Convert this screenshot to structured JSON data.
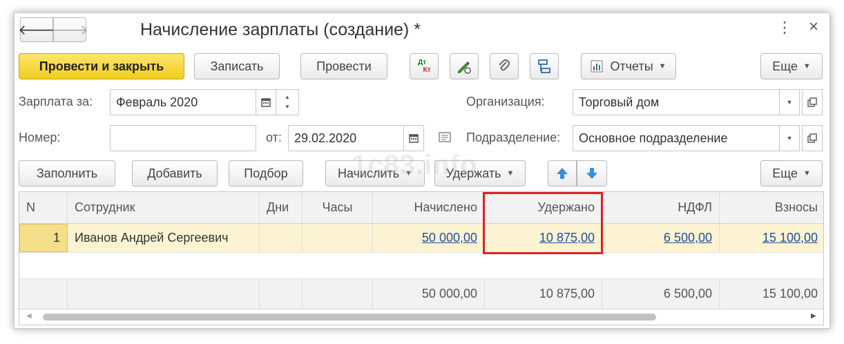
{
  "window": {
    "title": "Начисление зарплаты (создание) *",
    "more_glyph": "⋮",
    "close_glyph": "×"
  },
  "nav": {
    "back_glyph": "🡐",
    "forward_glyph": "🡒"
  },
  "toolbar": {
    "post_close": "Провести и закрыть",
    "save": "Записать",
    "post": "Провести",
    "dtkt_top": "Дт",
    "dtkt_bottom": "Кт",
    "reports": "Отчеты",
    "more": "Еще"
  },
  "form": {
    "salary_for_label": "Зарплата за:",
    "salary_for_value": "Февраль 2020",
    "organization_label": "Организация:",
    "organization_value": "Торговый дом",
    "number_label": "Номер:",
    "number_value": "",
    "date_label": "от:",
    "date_value": "29.02.2020",
    "division_label": "Подразделение:",
    "division_value": "Основное подразделение"
  },
  "table_toolbar": {
    "fill": "Заполнить",
    "add": "Добавить",
    "pick": "Подбор",
    "accrue": "Начислить",
    "withhold": "Удержать",
    "more": "Еще"
  },
  "table": {
    "headers": [
      "N",
      "Сотрудник",
      "Дни",
      "Часы",
      "Начислено",
      "Удержано",
      "НДФЛ",
      "Взносы"
    ],
    "rows": [
      {
        "n": "1",
        "employee": "Иванов Андрей Сергеевич",
        "days": "",
        "hours": "",
        "accrued": "50 000,00",
        "withheld": "10 875,00",
        "ndfl": "6 500,00",
        "contrib": "15 100,00"
      }
    ],
    "totals": {
      "accrued": "50 000,00",
      "withheld": "10 875,00",
      "ndfl": "6 500,00",
      "contrib": "15 100,00"
    }
  },
  "watermark": "1c83.info",
  "colors": {
    "primary": "#f5d63a",
    "link": "#1e50a0",
    "highlight": "#e01e24",
    "row_selected": "#fbf3d2"
  }
}
